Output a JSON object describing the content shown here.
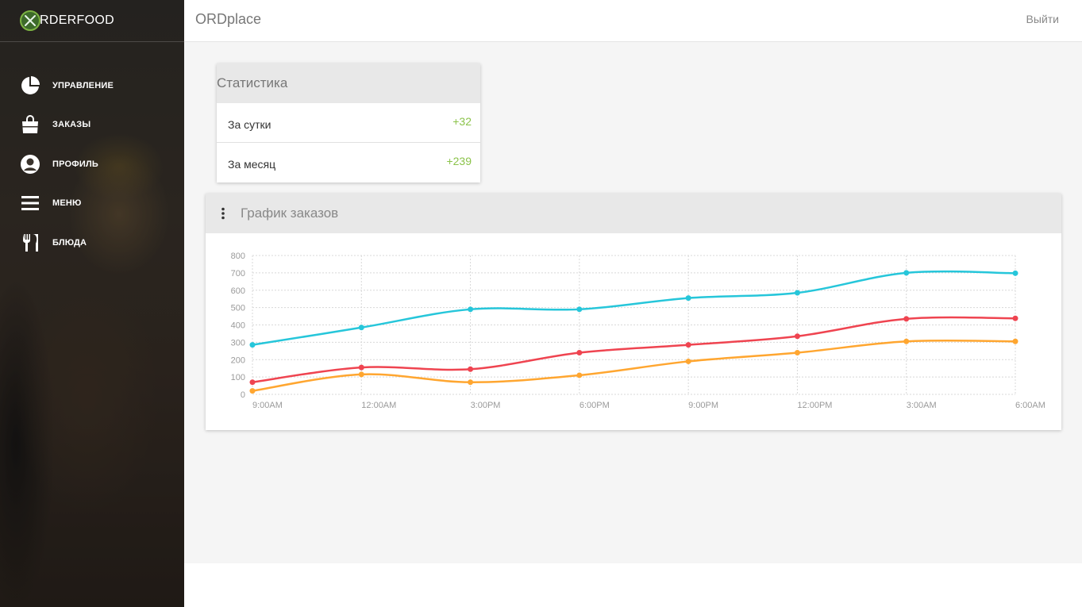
{
  "brand": {
    "logo_text": "RDERFOOD",
    "logo_icon": "fork-knife-circle-icon",
    "accent": "#7cb342"
  },
  "sidebar": {
    "items": [
      {
        "label": "УПРАВЛЕНИЕ",
        "icon": "pie-chart-icon"
      },
      {
        "label": "ЗАКАЗЫ",
        "icon": "shopping-bag-icon"
      },
      {
        "label": "ПРОФИЛЬ",
        "icon": "account-circle-icon"
      },
      {
        "label": "МЕНЮ",
        "icon": "menu-icon"
      },
      {
        "label": "БЛЮДА",
        "icon": "restaurant-icon"
      }
    ]
  },
  "header": {
    "title": "ORDplace",
    "logout_label": "Выйти"
  },
  "stats": {
    "title": "Статистика",
    "rows": [
      {
        "label": "За сутки",
        "value": "+32"
      },
      {
        "label": "За месяц",
        "value": "+239"
      }
    ],
    "value_color": "#8bc34a"
  },
  "orders_chart": {
    "title": "График заказов",
    "menu_icon": "more-vertical-icon"
  },
  "chart_data": {
    "type": "line",
    "categories": [
      "9:00AM",
      "12:00AM",
      "3:00PM",
      "6:00PM",
      "9:00PM",
      "12:00PM",
      "3:00AM",
      "6:00AM"
    ],
    "ylim": [
      0,
      800
    ],
    "yticks": [
      0,
      100,
      200,
      300,
      400,
      500,
      600,
      700,
      800
    ],
    "grid": true,
    "smooth": true,
    "series": [
      {
        "color": "#26c6da",
        "values": [
          285,
          385,
          490,
          490,
          555,
          585,
          700,
          698
        ]
      },
      {
        "color": "#ef4450",
        "values": [
          70,
          155,
          145,
          240,
          285,
          335,
          435,
          438
        ]
      },
      {
        "color": "#ffa630",
        "values": [
          20,
          115,
          70,
          110,
          190,
          240,
          305,
          305
        ]
      }
    ]
  }
}
